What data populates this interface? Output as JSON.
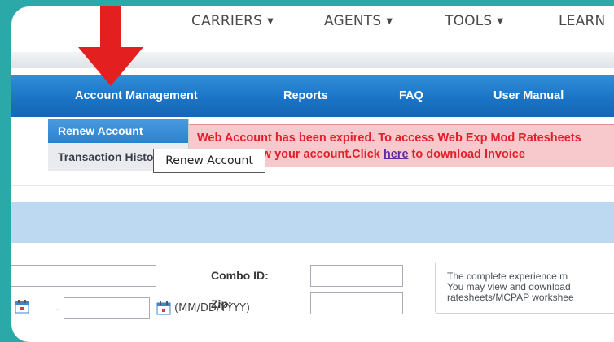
{
  "top_nav": {
    "items": [
      {
        "label": "CARRIERS"
      },
      {
        "label": "AGENTS"
      },
      {
        "label": "TOOLS"
      },
      {
        "label": "LEARN"
      }
    ]
  },
  "menu_bar": {
    "items": [
      {
        "label": "Account Management"
      },
      {
        "label": "Reports"
      },
      {
        "label": "FAQ"
      },
      {
        "label": "User Manual"
      }
    ]
  },
  "dropdown": {
    "items": [
      {
        "label": "Renew Account"
      },
      {
        "label": "Transaction History"
      }
    ]
  },
  "alert": {
    "line1": "Web Account has been expired. To access Web Exp Mod Ratesheets",
    "line2_pre": "please renew your account.Click ",
    "link": "here",
    "line2_post": " to download Invoice"
  },
  "tooltip": {
    "text": "Renew Account"
  },
  "form": {
    "combo_label": "Combo ID:",
    "zip_label": "Zip:",
    "date_dash": "-",
    "date_format": "(MM/DD/YYYY)"
  },
  "note": {
    "line1": "The complete experience m",
    "line2": "You may view and download",
    "line3": "ratesheets/MCPAP workshee"
  },
  "colors": {
    "border_teal": "#2aa9a8",
    "menu_blue": "#1a72c4",
    "alert_red": "#e0212b",
    "alert_bg": "#f8c9cc",
    "arrow_red": "#e41f1f"
  },
  "icons": [
    "chevron-down-icon",
    "red-arrow-icon",
    "calendar-icon"
  ]
}
